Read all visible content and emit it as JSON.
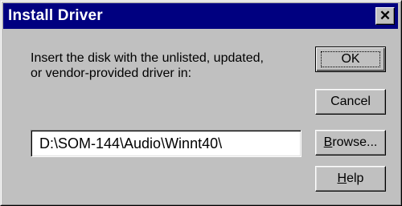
{
  "window": {
    "title": "Install Driver",
    "close_glyph": "✕"
  },
  "dialog": {
    "prompt_line1": "Insert the disk with the unlisted, updated,",
    "prompt_line2": "or vendor-provided driver in:",
    "path_value": "D:\\SOM-144\\Audio\\Winnt40\\"
  },
  "buttons": {
    "ok": "OK",
    "cancel": "Cancel",
    "browse_accel": "B",
    "browse_rest": "rowse...",
    "help_accel": "H",
    "help_rest": "elp"
  },
  "colors": {
    "titlebar": "#000080",
    "face": "#c0c0c0"
  }
}
